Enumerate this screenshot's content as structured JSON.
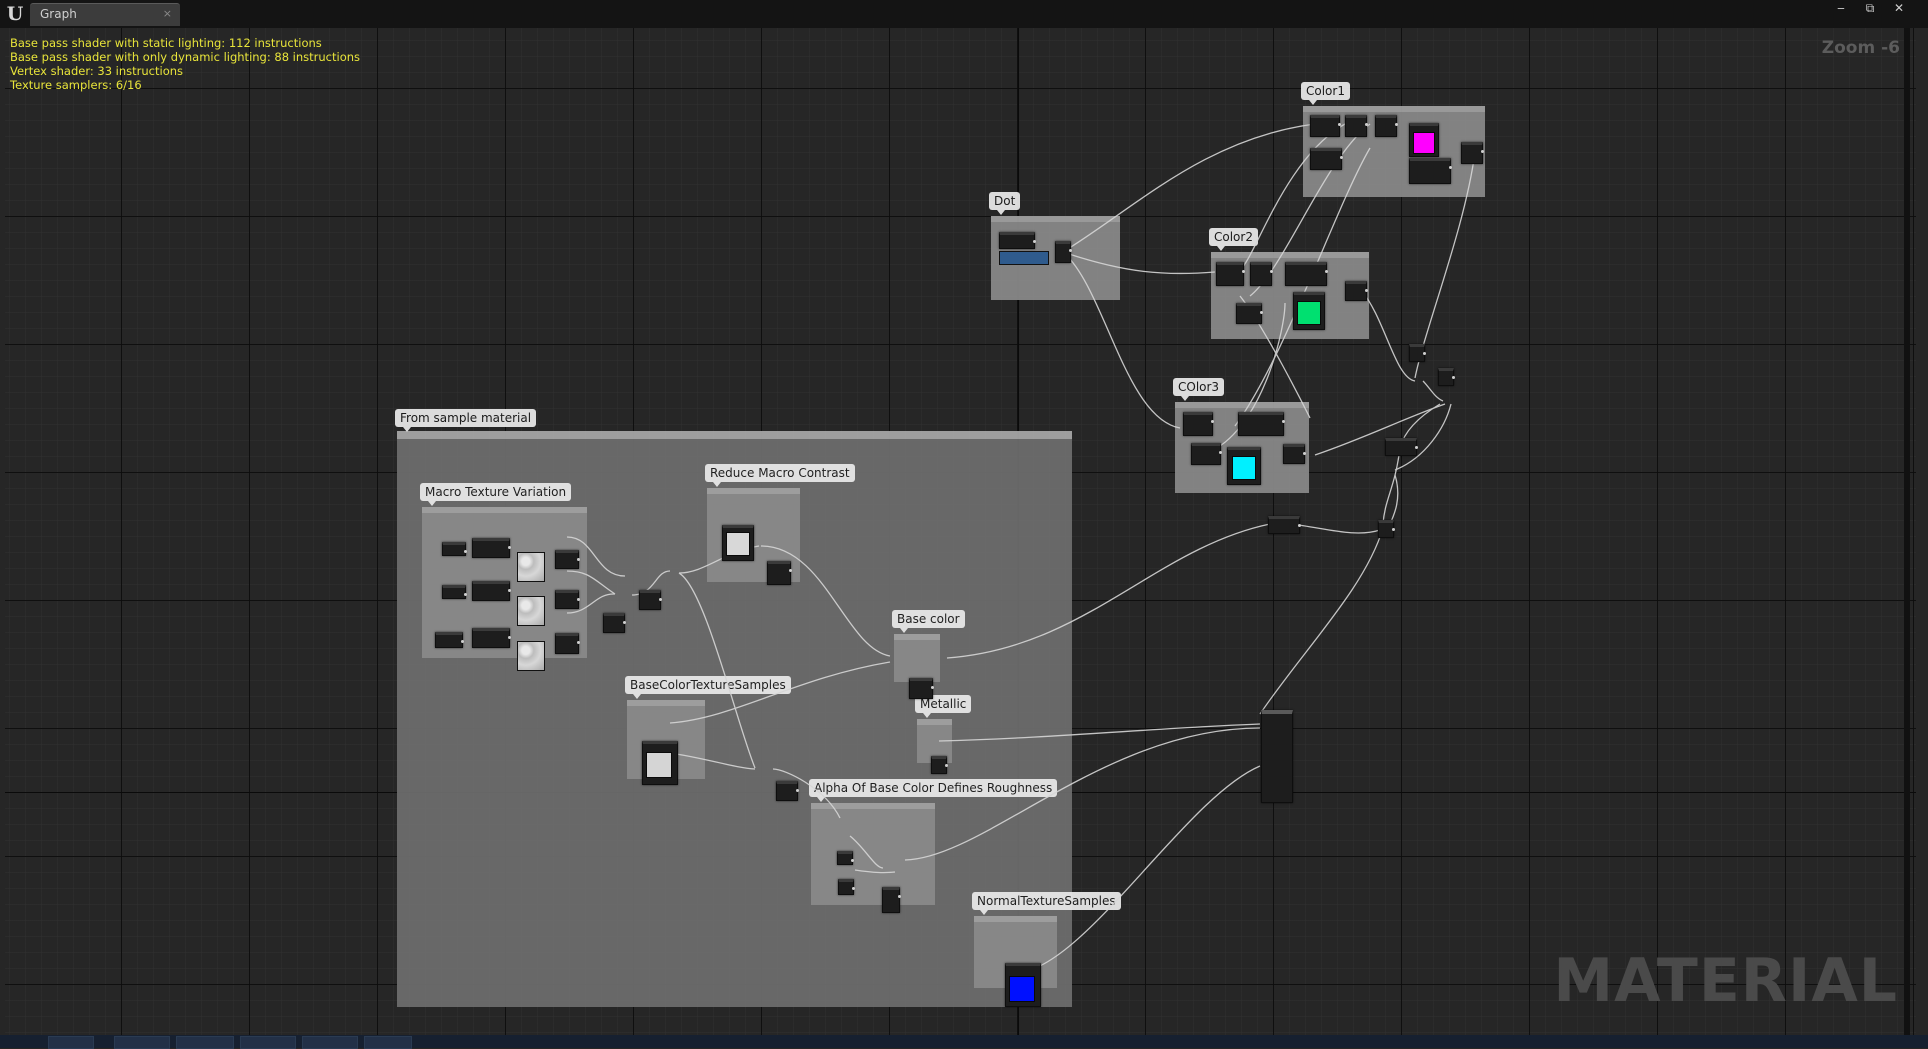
{
  "window": {
    "tab_title": "Graph",
    "tab_close": "×",
    "min": "‒",
    "restore": "⧉",
    "close": "✕"
  },
  "stats": [
    "Base pass shader with static lighting: 112 instructions",
    "Base pass shader with only dynamic lighting: 88 instructions",
    "Vertex shader: 33 instructions",
    "Texture samplers: 6/16"
  ],
  "zoom_label": "Zoom -6",
  "watermark": "MATERIAL",
  "comments": {
    "from_sample": "From sample material",
    "macro_texture_variation": "Macro Texture Variation",
    "reduce_macro_contrast": "Reduce Macro Contrast",
    "base_color": "Base color",
    "base_color_texture_samples": "BaseColorTextureSamples",
    "metallic": "Metallic",
    "alpha_roughness": "Alpha Of Base Color Defines Roughness",
    "normal_texture_samples": "NormalTextureSamples",
    "dot": "Dot",
    "color1": "Color1",
    "color2": "Color2",
    "color3": "COlor3"
  },
  "colors": {
    "color1_swatch": "#ff00ff",
    "color2_swatch": "#00e070",
    "color3_swatch": "#00f0ff",
    "normal_swatch": "#0010ff",
    "stats_text": "#e8e43a"
  }
}
